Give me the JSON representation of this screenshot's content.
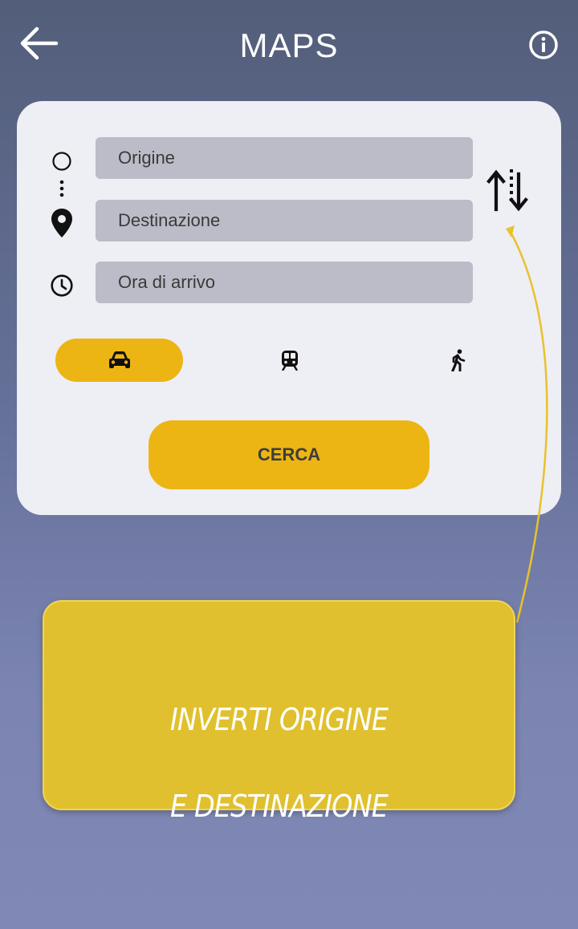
{
  "header": {
    "title": "MAPS",
    "back_icon": "arrow-left-icon",
    "info_icon": "info-circle-icon"
  },
  "form": {
    "origin": {
      "placeholder": "Origine",
      "value": ""
    },
    "destination": {
      "placeholder": "Destinazione",
      "value": ""
    },
    "arrival_time": {
      "placeholder": "Ora di arrivo",
      "value": ""
    },
    "swap_icon": "swap-vertical-icon"
  },
  "modes": [
    {
      "icon": "car-icon",
      "selected": true
    },
    {
      "icon": "train-icon",
      "selected": false
    },
    {
      "icon": "walk-icon",
      "selected": false
    }
  ],
  "search_button": {
    "label": "CERCA"
  },
  "callout": {
    "line1": "INVERTI ORIGINE",
    "line2": "E DESTINAZIONE"
  },
  "colors": {
    "accent": "#ecb514",
    "callout": "#e0c02e",
    "card": "#eeeef5",
    "field": "#bcbcc8"
  }
}
